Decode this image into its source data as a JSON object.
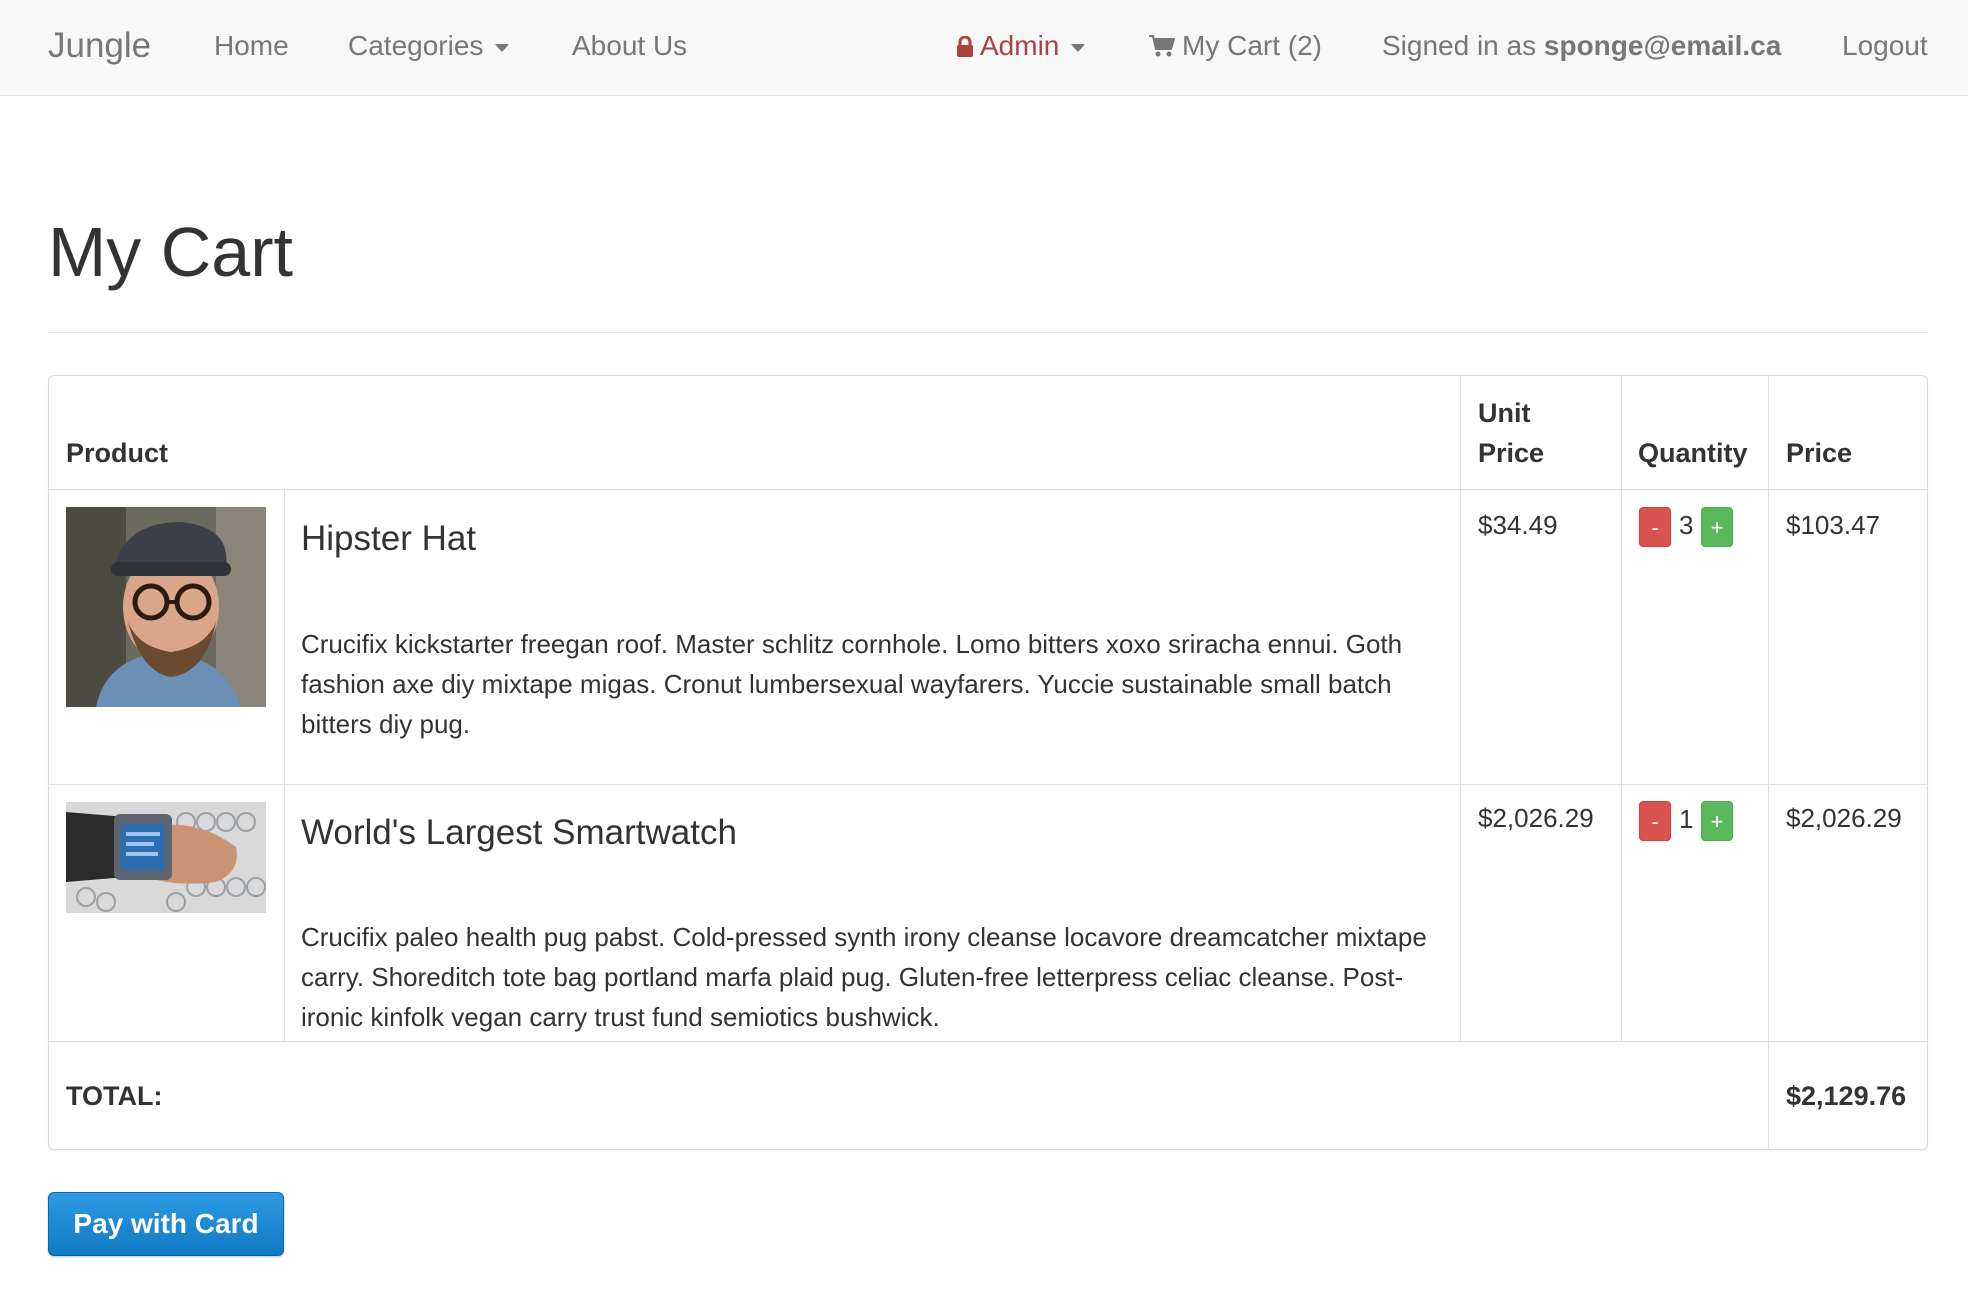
{
  "navbar": {
    "brand": "Jungle",
    "home": "Home",
    "categories": "Categories",
    "about": "About Us",
    "admin": "Admin",
    "cart": "My Cart (2)",
    "signed_in_prefix": "Signed in as",
    "signed_in_email": "sponge@email.ca",
    "logout": "Logout",
    "icons": {
      "admin": "lock-icon",
      "cart": "shopping-cart-icon"
    },
    "colors": {
      "admin": "#a94442",
      "text": "#777777"
    }
  },
  "page": {
    "title": "My Cart"
  },
  "table": {
    "headers": {
      "product": "Product",
      "unit_price_line1": "Unit",
      "unit_price_line2": "Price",
      "quantity": "Quantity",
      "price": "Price"
    },
    "rows": [
      {
        "name": "Hipster Hat",
        "description": "Crucifix kickstarter freegan roof. Master schlitz cornhole. Lomo bitters xoxo sriracha ennui. Goth fashion axe diy mixtape migas. Cronut lumbersexual wayfarers. Yuccie sustainable small batch bitters diy pug.",
        "unit_price": "$34.49",
        "quantity": "3",
        "price": "$103.47",
        "minus": "-",
        "plus": "+"
      },
      {
        "name": "World's Largest Smartwatch",
        "description": "Crucifix paleo health pug pabst. Cold-pressed synth irony cleanse locavore dreamcatcher mixtape carry. Shoreditch tote bag portland marfa plaid pug. Gluten-free letterpress celiac cleanse. Post-ironic kinfolk vegan carry trust fund semiotics bushwick.",
        "unit_price": "$2,026.29",
        "quantity": "1",
        "price": "$2,026.29",
        "minus": "-",
        "plus": "+"
      }
    ],
    "total_label": "TOTAL:",
    "total_value": "$2,129.76"
  },
  "pay_button": "Pay with Card",
  "colors": {
    "minus": "#d9534f",
    "plus": "#5cb85c",
    "pay": "#1a87d1"
  }
}
